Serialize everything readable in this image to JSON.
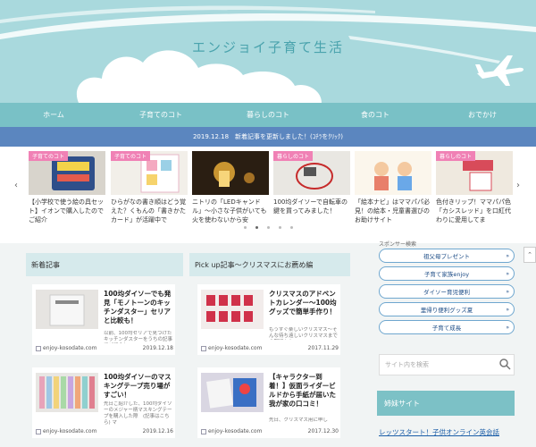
{
  "site": {
    "title": "エンジョイ子育て生活"
  },
  "nav": {
    "items": [
      "ホーム",
      "子育てのコト",
      "暮らしのコト",
      "食のコト",
      "おでかけ"
    ]
  },
  "news": {
    "text": "2019.12.18　新着記事を更新しました！(ｺﾁﾗをｸﾘｯｸ)"
  },
  "carousel": {
    "items": [
      {
        "tag": "子育てのコト",
        "text": "【小学校で使う絵の具セット】イオンで購入したのでご紹介"
      },
      {
        "tag": "子育てのコト",
        "text": "ひらがなの書き順はどう覚えた？くもんの「書きかたカード」が活躍中で"
      },
      {
        "tag": "",
        "text": "ニトリの「LEDキャンドル」〜小さな子供がいても火を使わないから安"
      },
      {
        "tag": "暮らしのコト",
        "text": "100均ダイソーで自転車の鍵を買ってみました！"
      },
      {
        "tag": "",
        "text": "「絵本ナビ」はママパパ必見！の絵本・児童書選びのお助けサイト"
      },
      {
        "tag": "暮らしのコト",
        "text": "色付きリップ！ママパパ色「カシスレッド」を口紅代わりに愛用してま"
      }
    ],
    "prev": "‹",
    "next": "›"
  },
  "columns": {
    "left_title": "新着記事",
    "right_title": "Pick up記事〜クリスマスにお薦め編"
  },
  "cards": [
    {
      "title": "100均ダイソーでも発見「モノトーンのキッチンダスター」セリアと比較も！",
      "desc": "以前、100均セリアで見つけたキッチンダスターをうちの記事でご紹介し",
      "site": "enjoy-kosodate.com",
      "date": "2019.12.18"
    },
    {
      "title": "クリスマスのアドベントカレンダー〜100均グッズで簡単手作り！",
      "desc": "もうすぐ楽しいクリスマス〜そんな待ち遠しいクリスマスまでの期間もお",
      "site": "enjoy-kosodate.com",
      "date": "2017.11.29"
    },
    {
      "title": "100均ダイソーのマスキングテープ売り場がすごい！",
      "desc": "先日ご紹介した、100均ダイソーのメジャー柄マスキングテープを購入した際　(記事はこちら) マ",
      "site": "enjoy-kosodate.com",
      "date": "2019.12.16"
    },
    {
      "title": "【キャラクター到着！】仮面ライダービルドから手紙が届いた我が家の口コミ！",
      "desc": "先日、クリスマス用に申し",
      "site": "enjoy-kosodate.com",
      "date": "2017.12.30"
    }
  ],
  "sidebar": {
    "sponsor_label": "スポンサー検索",
    "buttons": [
      "祖父母プレゼント",
      "子育て家族enjoy",
      "ダイソー育児便利",
      "里帰り便利グッズ夏",
      "子育て成長"
    ],
    "search_placeholder": "サイト内を検索",
    "sister_title": "姉妹サイト",
    "sister_link": "レッツスタート！子供オンライン英会話"
  },
  "colors": {
    "sky": "#a9d9dd",
    "nav": "#79c1c6",
    "news": "#5b86bf",
    "tag": "#f081b5"
  }
}
